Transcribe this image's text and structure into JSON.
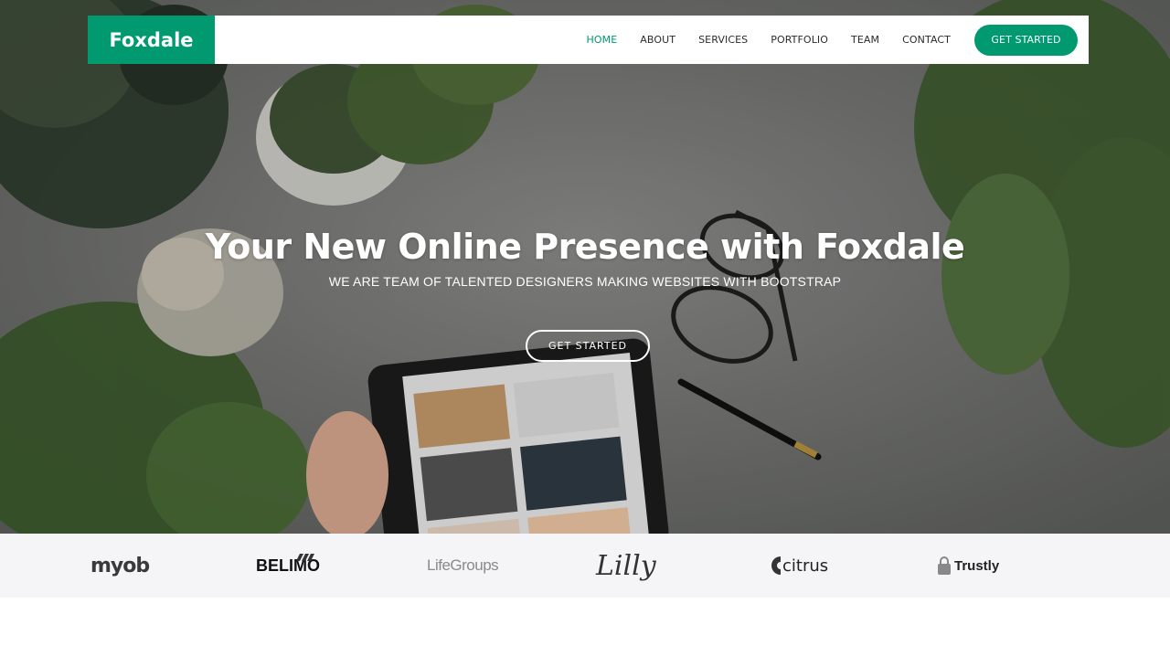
{
  "brand": {
    "name": "Foxdale",
    "accent": "#009970"
  },
  "nav": {
    "items": [
      {
        "label": "HOME",
        "active": true
      },
      {
        "label": "ABOUT",
        "active": false
      },
      {
        "label": "SERVICES",
        "active": false
      },
      {
        "label": "PORTFOLIO",
        "active": false
      },
      {
        "label": "TEAM",
        "active": false
      },
      {
        "label": "CONTACT",
        "active": false
      }
    ],
    "cta_label": "GET STARTED"
  },
  "hero": {
    "title": "Your New Online Presence with Foxdale",
    "subtitle": "WE ARE TEAM OF TALENTED DESIGNERS MAKING WEBSITES WITH BOOTSTRAP",
    "button_label": "GET STARTED"
  },
  "clients": {
    "logos": [
      "myob",
      "BELIMO",
      "LifeGroups",
      "Lilly",
      "citrus",
      "Trustly"
    ]
  }
}
